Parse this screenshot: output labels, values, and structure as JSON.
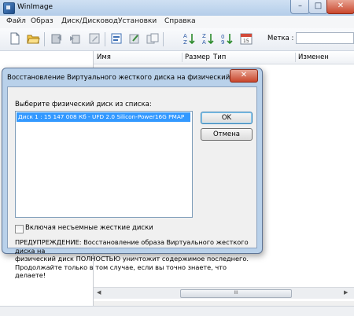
{
  "window": {
    "title": "WinImage",
    "controls": {
      "minimize": "–",
      "maximize": "□",
      "close": "✕"
    }
  },
  "menu": [
    "Файл",
    "Образ",
    "Диск/Дисковод",
    "Установки",
    "Справка"
  ],
  "toolbar": {
    "icons": [
      "new-document",
      "open-folder",
      "extract",
      "inject",
      "edit",
      "properties",
      "delete",
      "sort-az",
      "sort-za",
      "sort-ascending",
      "sort-descending",
      "calendar"
    ],
    "label_caption": "Метка :",
    "label_value": ""
  },
  "file_list": {
    "columns": [
      "Имя",
      "Размер",
      "Тип",
      "Изменен"
    ],
    "scroll_grip": "III"
  },
  "dialog": {
    "title": "Восстановление Виртуального жесткого диска на физический ди...",
    "prompt": "Выберите физический диск из списка:",
    "disks": [
      "Диск 1 : 15 147 008 Кб - UFD 2.0 Silicon-Power16G PMAP"
    ],
    "ok": "OK",
    "cancel": "Отмена",
    "include_fixed_label": "Включая несъемные жесткие диски",
    "include_fixed_checked": false,
    "warning_line1": "ПРЕДУПРЕЖДЕНИЕ: Восстановление образа Виртуального жесткого диска на",
    "warning_line2": "физический диск ПОЛНОСТЬЮ уничтожит содержимое последнего.",
    "warning_line3": "Продолжайте только в том случае, если вы точно знаете, что делаете!"
  }
}
